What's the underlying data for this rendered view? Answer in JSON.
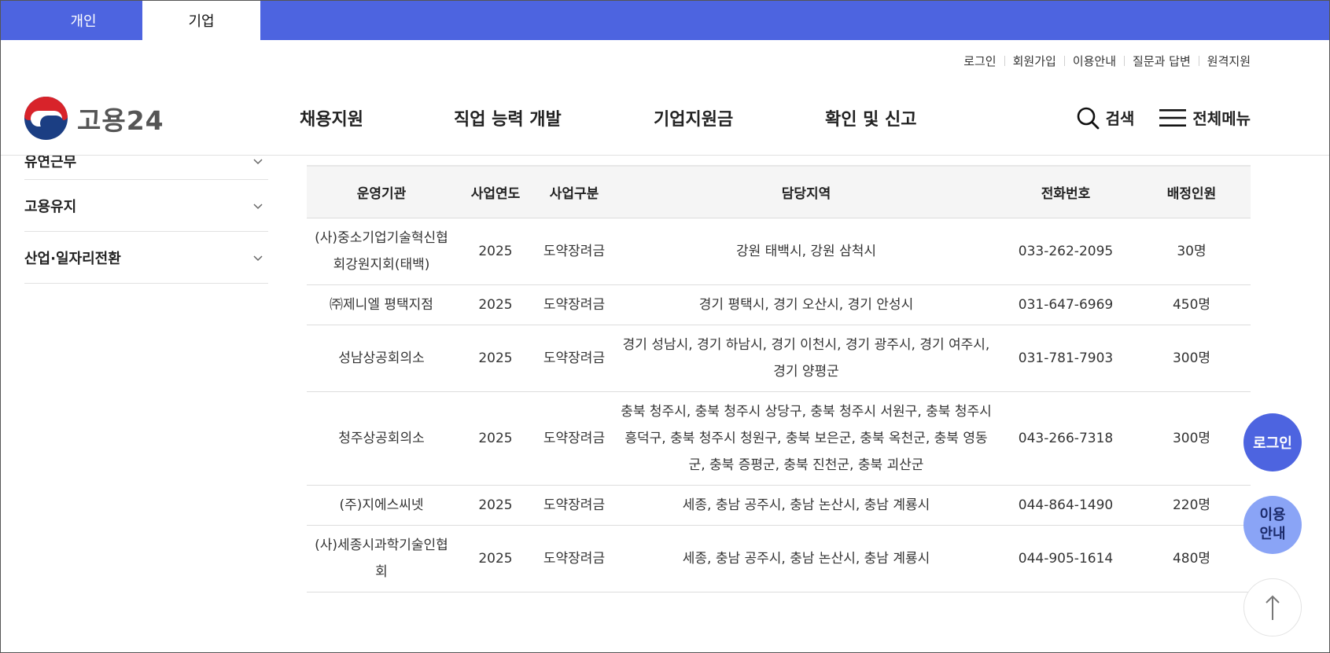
{
  "user_tabs": {
    "personal": "개인",
    "corporate": "기업"
  },
  "util_links": [
    "로그인",
    "회원가입",
    "이용안내",
    "질문과 답변",
    "원격지원"
  ],
  "logo_text": "고용24",
  "gnb": [
    "채용지원",
    "직업 능력 개발",
    "기업지원금",
    "확인 및 신고"
  ],
  "tools": {
    "search": "검색",
    "menu": "전체메뉴"
  },
  "sidebar": {
    "partial": "유연근무",
    "items": [
      "고용유지",
      "산업·일자리전환"
    ]
  },
  "table": {
    "headers": [
      "운영기관",
      "사업연도",
      "사업구분",
      "담당지역",
      "전화번호",
      "배정인원"
    ],
    "rows": [
      [
        "(사)중소기업기술혁신협회강원지회(태백)",
        "2025",
        "도약장려금",
        "강원 태백시, 강원 삼척시",
        "033-262-2095",
        "30명"
      ],
      [
        "㈜제니엘 평택지점",
        "2025",
        "도약장려금",
        "경기 평택시, 경기 오산시, 경기 안성시",
        "031-647-6969",
        "450명"
      ],
      [
        "성남상공회의소",
        "2025",
        "도약장려금",
        "경기 성남시, 경기 하남시, 경기 이천시, 경기 광주시, 경기 여주시, 경기 양평군",
        "031-781-7903",
        "300명"
      ],
      [
        "청주상공회의소",
        "2025",
        "도약장려금",
        "충북 청주시, 충북 청주시 상당구, 충북 청주시 서원구, 충북 청주시 흥덕구, 충북 청주시 청원구, 충북 보은군, 충북 옥천군, 충북 영동군, 충북 증평군, 충북 진천군, 충북 괴산군",
        "043-266-7318",
        "300명"
      ],
      [
        "(주)지에스씨넷",
        "2025",
        "도약장려금",
        "세종, 충남 공주시, 충남 논산시, 충남 계룡시",
        "044-864-1490",
        "220명"
      ],
      [
        "(사)세종시과학기술인협회",
        "2025",
        "도약장려금",
        "세종, 충남 공주시, 충남 논산시, 충남 계룡시",
        "044-905-1614",
        "480명"
      ]
    ]
  },
  "floating": {
    "login": "로그인",
    "guide_line1": "이용",
    "guide_line2": "안내"
  },
  "colors": {
    "brand": "#4d64e0",
    "guide": "#8aa4f6"
  }
}
